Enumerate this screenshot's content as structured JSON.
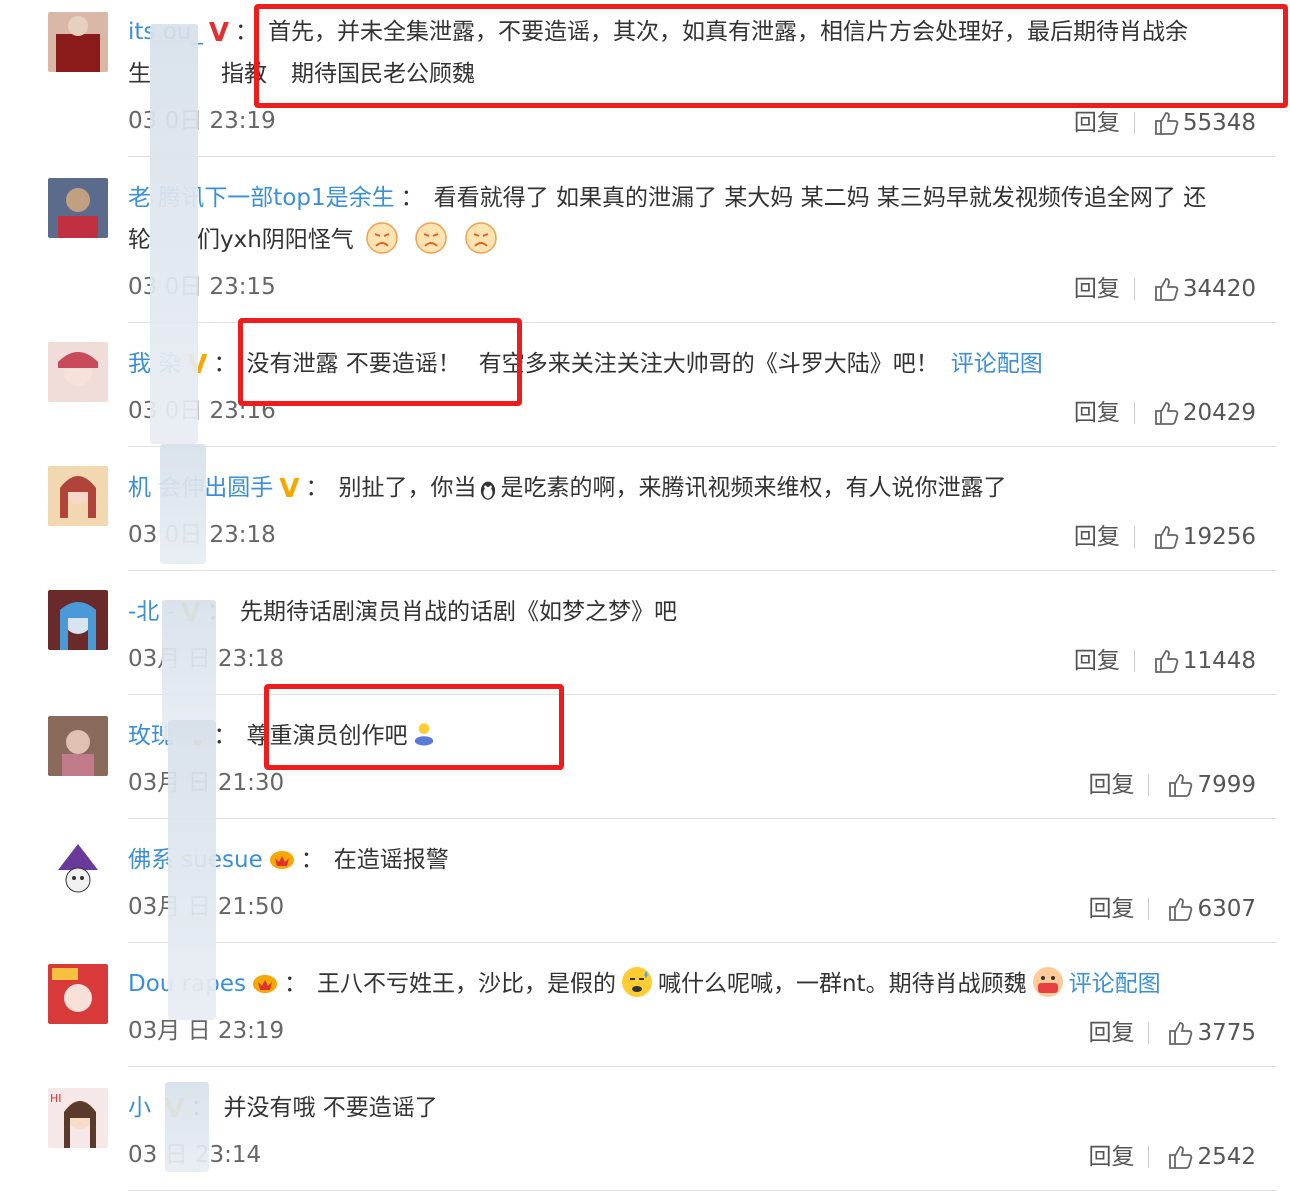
{
  "comments": [
    {
      "user": "its  ou_",
      "badge": "V",
      "badge_color": "red",
      "text": "首先，并未全集泄露，不要造谣，其次，如真有泄露，相信片方会处理好，最后期待肖战余",
      "text2a": "生",
      "text2b": "指教",
      "text2c": "期待国民老公顾魏",
      "time": "03  0日 23:19",
      "likes": "55348",
      "reply": "回复",
      "avatar_color": "#8b1a1a"
    },
    {
      "user": "老  腾讯下一部top1是余生",
      "text": "看看就得了 如果真的泄漏了 某大妈 某二妈 某三妈早就发视频传追全网了 还",
      "text2a": "轮",
      "text2b": "们yxh阴阳怪气",
      "time": "03  0日 23:15",
      "likes": "34420",
      "reply": "回复",
      "avatar_color": "#5a6b8c"
    },
    {
      "user": "我  染",
      "badge": "V",
      "text": "没有泄露 不要造谣！",
      "text_extra": "有空多来关注关注大帅哥的《斗罗大陆》吧！",
      "link": "评论配图",
      "time": "03  0日 23:16",
      "likes": "20429",
      "reply": "回复",
      "avatar_color": "#c97b7b"
    },
    {
      "user": "机  会伸出圆手",
      "badge": "V",
      "text": "别扯了，你当",
      "text_after": "是吃素的啊，来腾讯视频来维权，有人说你泄露了",
      "time": "03  0日 23:18",
      "likes": "19256",
      "reply": "回复",
      "avatar_color": "#b0443a"
    },
    {
      "user": "-北  -",
      "badge": "V",
      "text": "先期待话剧演员肖战的话剧《如梦之梦》吧",
      "time": "03月  日 23:18",
      "likes": "11448",
      "reply": "回复",
      "avatar_color": "#3a7fb8"
    },
    {
      "user": "玫瑰  ",
      "badge": "V",
      "text": "尊重演员创作吧",
      "time": "03月  日 21:30",
      "likes": "7999",
      "reply": "回复",
      "avatar_color": "#7a5a4a"
    },
    {
      "user": "佛系  suesue",
      "text": "在造谣报警",
      "time": "03月  日 21:50",
      "likes": "6307",
      "reply": "回复",
      "avatar_color": "#6a3a9a"
    },
    {
      "user": "Dou  rapes",
      "text": "王八不亏姓王，沙比，是假的",
      "text_after": "喊什么呢喊，一群nt。期待肖战顾魏",
      "link": "评论配图",
      "time": "03月  日 23:19",
      "likes": "3775",
      "reply": "回复",
      "avatar_color": "#d83a3a"
    },
    {
      "user": "小  ",
      "badge": "V",
      "text": "并没有哦 不要造谣了",
      "time": "03  日 23:14",
      "likes": "2542",
      "reply": "回复",
      "avatar_color": "#e8b0a0"
    }
  ]
}
